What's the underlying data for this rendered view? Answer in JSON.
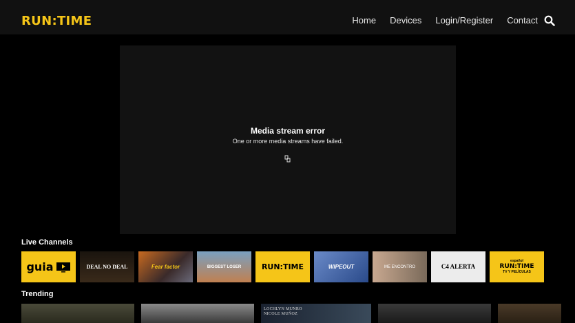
{
  "header": {
    "logo_text": "RUN:TIME",
    "nav": [
      "Home",
      "Devices",
      "Login/Register",
      "Contact"
    ],
    "search_icon": "search-icon"
  },
  "player": {
    "error_title": "Media stream error",
    "error_message": "One or more media streams have failed.",
    "error_icon": "broken-file-icon"
  },
  "live_channels": {
    "title": "Live Channels",
    "channels": [
      {
        "label": "guia",
        "bg": "#f5c518",
        "fg": "#000"
      },
      {
        "label": "DEAL NO DEAL",
        "bg": "#2a2018",
        "fg": "#fff"
      },
      {
        "label": "Fear factor",
        "bg": "#7a4a20",
        "fg": "#f5c518"
      },
      {
        "label": "BIGGEST LOSER",
        "bg": "#6a8fb0",
        "fg": "#fff"
      },
      {
        "label": "RUN:TIME",
        "bg": "#f5c518",
        "fg": "#000"
      },
      {
        "label": "WIPEOUT",
        "bg": "#3a5a9a",
        "fg": "#fff"
      },
      {
        "label": "ME ENCONTRO",
        "bg": "#9a8a7a",
        "fg": "#fff"
      },
      {
        "label": "C4 ALERTA",
        "bg": "#e8e8e8",
        "fg": "#000"
      },
      {
        "label": "RUN:TIME",
        "sub": "español",
        "sub2": "TV Y PELÍCULAS",
        "bg": "#f5c518",
        "fg": "#000"
      }
    ]
  },
  "trending": {
    "title": "Trending",
    "items": [
      {
        "label": "",
        "bg": "#3a3a2a"
      },
      {
        "label": "",
        "bg": "#5a5a5a"
      },
      {
        "label": "LOCHLYN MUNRO\nNICOLE MUÑOZ",
        "bg": "#1e2a3a"
      },
      {
        "label": "",
        "bg": "#2a2a2a"
      },
      {
        "label": "",
        "bg": "#3a3020"
      }
    ]
  }
}
